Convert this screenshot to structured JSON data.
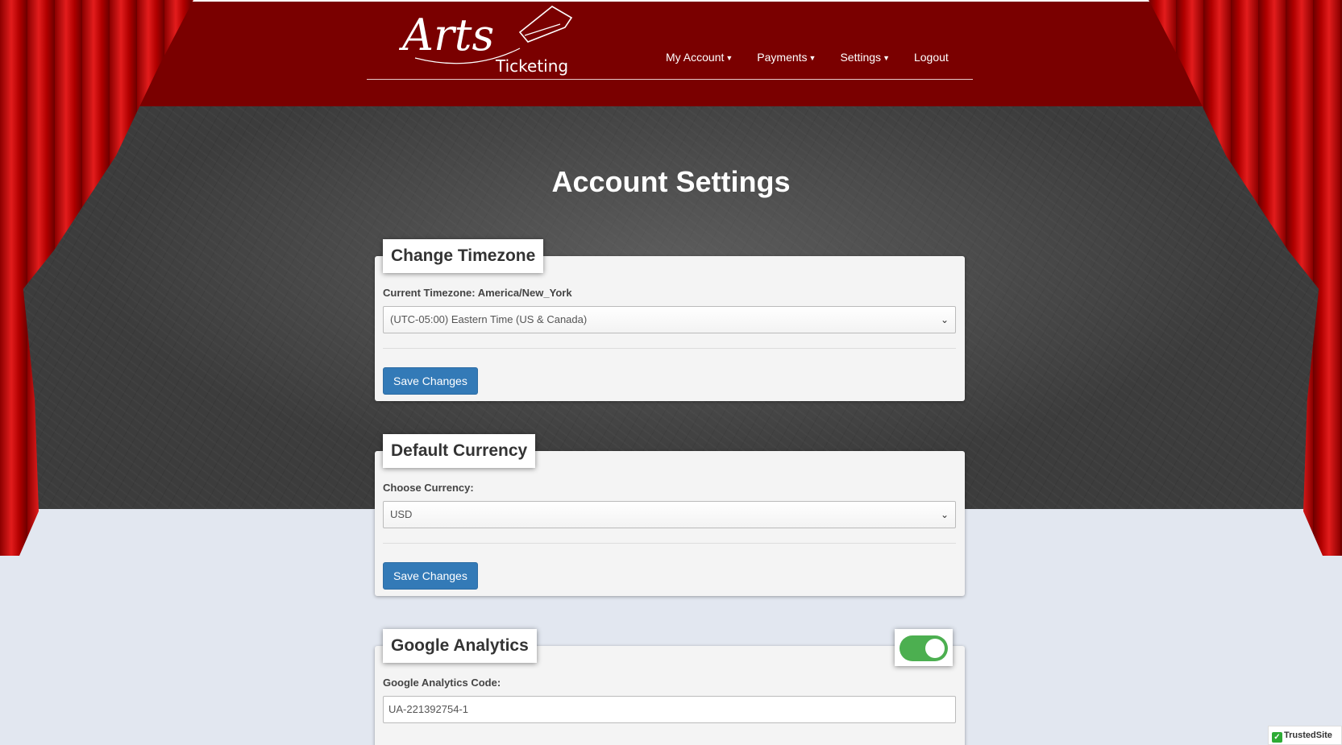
{
  "header": {
    "logo_script": "Arts",
    "logo_text": "Ticketing",
    "nav": [
      {
        "label": "My Account",
        "dropdown": true
      },
      {
        "label": "Payments",
        "dropdown": true
      },
      {
        "label": "Settings",
        "dropdown": true
      },
      {
        "label": "Logout",
        "dropdown": false
      }
    ]
  },
  "page": {
    "title": "Account Settings"
  },
  "timezone": {
    "heading": "Change Timezone",
    "current_label": "Current Timezone: America/New_York",
    "selected": "(UTC-05:00) Eastern Time (US & Canada)",
    "save_label": "Save Changes"
  },
  "currency": {
    "heading": "Default Currency",
    "label": "Choose Currency:",
    "selected": "USD",
    "save_label": "Save Changes"
  },
  "analytics": {
    "heading": "Google Analytics",
    "enabled": true,
    "label": "Google Analytics Code:",
    "code": "UA-221392754-1"
  },
  "badge": {
    "text": "TrustedSite"
  },
  "colors": {
    "header_bg": "#7a0000",
    "primary_button": "#337ab7",
    "toggle_on": "#4caf50"
  }
}
